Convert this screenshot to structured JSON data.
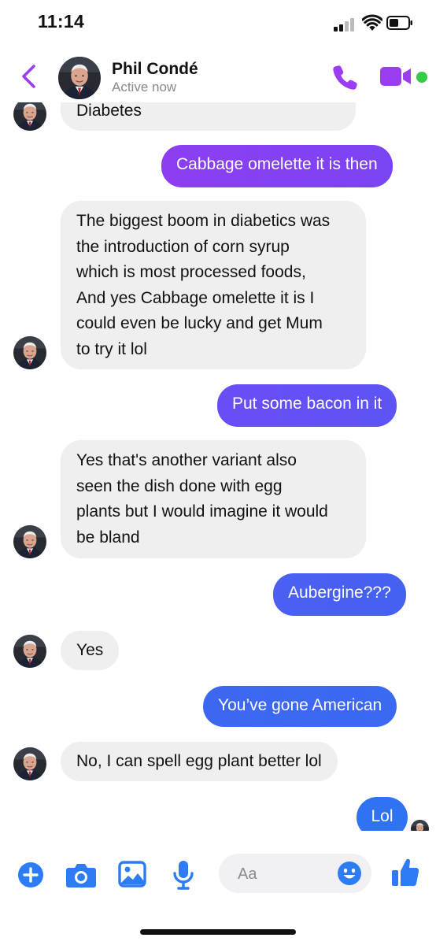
{
  "status": {
    "time": "11:14"
  },
  "contact": {
    "name": "Phil Condé",
    "status": "Active now"
  },
  "messages": [
    {
      "from": "them",
      "text": "Diabetes"
    },
    {
      "from": "me",
      "text": "Cabbage omelette it is then"
    },
    {
      "from": "them",
      "lines": [
        "The biggest boom in diabetics was",
        "the introduction of corn syrup",
        "which is most processed foods,",
        "And yes Cabbage omelette it is I",
        "could even be lucky and get Mum",
        "to try it lol"
      ]
    },
    {
      "from": "me",
      "text": "Put some bacon in it"
    },
    {
      "from": "them",
      "lines": [
        "Yes that's another variant also",
        "seen the dish done with egg",
        "plants but I would imagine it would",
        "be bland"
      ]
    },
    {
      "from": "me",
      "text": "Aubergine???"
    },
    {
      "from": "them",
      "text": "Yes"
    },
    {
      "from": "me",
      "text": "You’ve gone American"
    },
    {
      "from": "them",
      "text": "No, I can spell egg plant better lol"
    },
    {
      "from": "me",
      "text": "Lol"
    }
  ],
  "composer": {
    "placeholder": "Aa"
  },
  "icons": {
    "back": "chevron-left-icon",
    "call": "phone-icon",
    "video": "video-camera-icon",
    "plus": "plus-circle-icon",
    "camera": "camera-icon",
    "photo": "image-icon",
    "mic": "microphone-icon",
    "emoji": "smiley-icon",
    "like": "thumbs-up-icon"
  },
  "colors": {
    "accent_purple": "#9b3df0",
    "bubble_gradient": [
      "#8e3ef2",
      "#6b4cf5",
      "#3f67f0",
      "#2f72f2"
    ],
    "incoming_bubble": "#efefef",
    "composer_blue": "#2d7cf6",
    "online": "#33cc44"
  }
}
